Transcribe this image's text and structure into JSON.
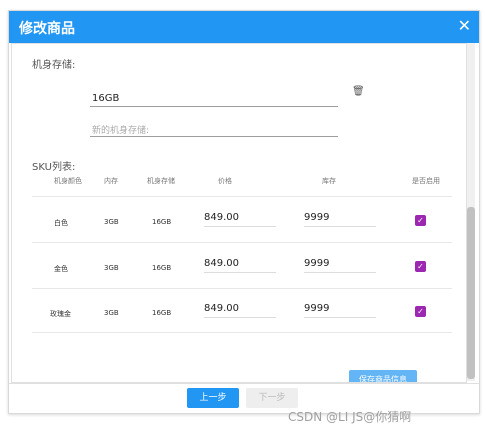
{
  "dialog": {
    "title": "修改商品",
    "close_icon": "close-icon"
  },
  "storage": {
    "label": "机身存储:",
    "value": "16GB",
    "new_placeholder": "新的机身存储:",
    "delete_icon": "trash-icon"
  },
  "sku": {
    "label": "SKU列表:",
    "columns": [
      "机身颜色",
      "内存",
      "机身存储",
      "价格",
      "库存",
      "是否启用"
    ],
    "rows": [
      {
        "color": "白色",
        "memory": "3GB",
        "storage": "16GB",
        "price": "849.00",
        "stock": "9999",
        "enabled": true
      },
      {
        "color": "金色",
        "memory": "3GB",
        "storage": "16GB",
        "price": "849.00",
        "stock": "9999",
        "enabled": true
      },
      {
        "color": "玫瑰金",
        "memory": "3GB",
        "storage": "16GB",
        "price": "849.00",
        "stock": "9999",
        "enabled": true
      }
    ],
    "save_label": "保存商品信息"
  },
  "footer": {
    "prev_label": "上一步",
    "next_label": "下一步"
  },
  "watermark": "CSDN @LI JS@你猜啊",
  "colors": {
    "header": "#2196f3",
    "checkbox": "#9c27b0",
    "save_button": "#64b5f6"
  }
}
